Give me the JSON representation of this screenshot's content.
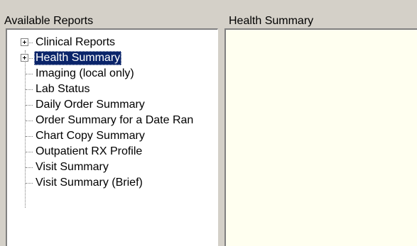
{
  "left_panel": {
    "title": "Available Reports",
    "items": [
      {
        "label": "Clinical Reports",
        "expandable": true,
        "selected": false
      },
      {
        "label": "Health Summary",
        "expandable": true,
        "selected": true
      },
      {
        "label": "Imaging (local only)",
        "expandable": false,
        "selected": false
      },
      {
        "label": "Lab Status",
        "expandable": false,
        "selected": false
      },
      {
        "label": "Daily Order Summary",
        "expandable": false,
        "selected": false
      },
      {
        "label": "Order Summary for a Date Ran",
        "expandable": false,
        "selected": false
      },
      {
        "label": "Chart Copy Summary",
        "expandable": false,
        "selected": false
      },
      {
        "label": "Outpatient RX Profile",
        "expandable": false,
        "selected": false
      },
      {
        "label": "Visit Summary",
        "expandable": false,
        "selected": false
      },
      {
        "label": "Visit Summary (Brief)",
        "expandable": false,
        "selected": false
      }
    ]
  },
  "right_panel": {
    "title": "Health Summary"
  },
  "colors": {
    "window_bg": "#d4d0c8",
    "selection_bg": "#0a246a",
    "viewer_bg": "#fffff0"
  }
}
